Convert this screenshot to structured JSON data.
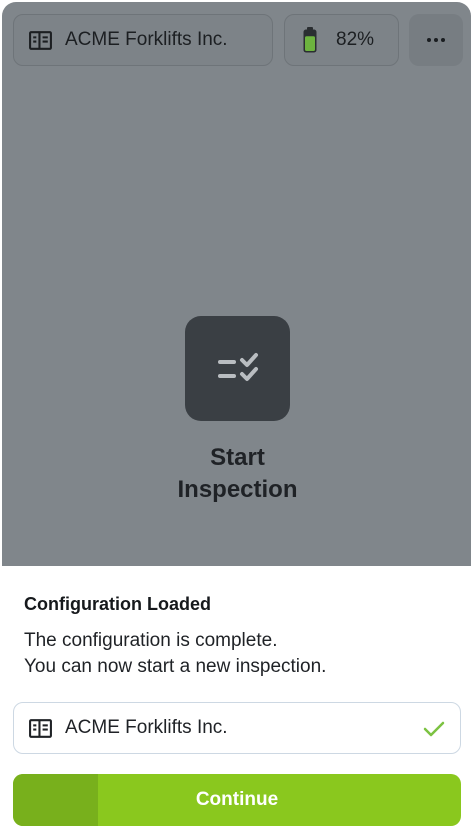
{
  "header": {
    "company_name": "ACME Forklifts Inc.",
    "battery_level": "82%",
    "battery_fraction": 0.82,
    "more_icon": "more-horizontal-icon"
  },
  "center": {
    "start_label": "Start\nInspection",
    "icon": "checklist-icon"
  },
  "sheet": {
    "title": "Configuration Loaded",
    "message": "The configuration is complete.\nYou can now start a new inspection.",
    "selected_company": "ACME Forklifts Inc.",
    "continue_label": "Continue",
    "continue_progress": 0.19
  },
  "colors": {
    "accent": "#8ac81e",
    "accent_progress": "#78b01c",
    "battery": "#6db33f",
    "check": "#7cc242",
    "overlay": "#80868b"
  }
}
